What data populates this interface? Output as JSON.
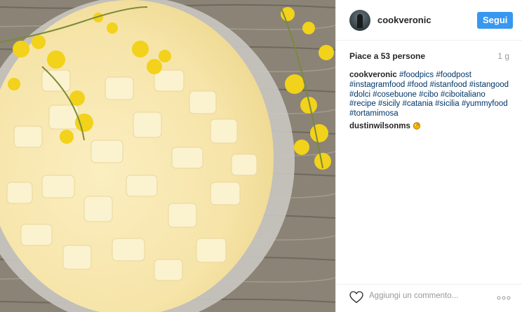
{
  "photo": {
    "alt": ""
  },
  "header": {
    "username": "cookveronic",
    "follow_label": "Segui"
  },
  "stats": {
    "likes": "Piace a 53 persone",
    "time": "1 g"
  },
  "caption": {
    "username": "cookveronic",
    "hashtags": [
      "#foodpics",
      "#foodpost",
      "#instagramfood",
      "#food",
      "#istanfood",
      "#istangood",
      "#dolci",
      "#cosebuone",
      "#cibo",
      "#ciboitaliano",
      "#recipe",
      "#sicily",
      "#catania",
      "#sicilia",
      "#yummyfood",
      "#tortamimosa"
    ]
  },
  "comment": {
    "username": "dustinwilsonms",
    "icon": "ok-hand-emoji"
  },
  "footer": {
    "comment_placeholder": "Aggiungi un commento...",
    "like_icon": "heart-icon",
    "more_icon": "more-icon"
  }
}
